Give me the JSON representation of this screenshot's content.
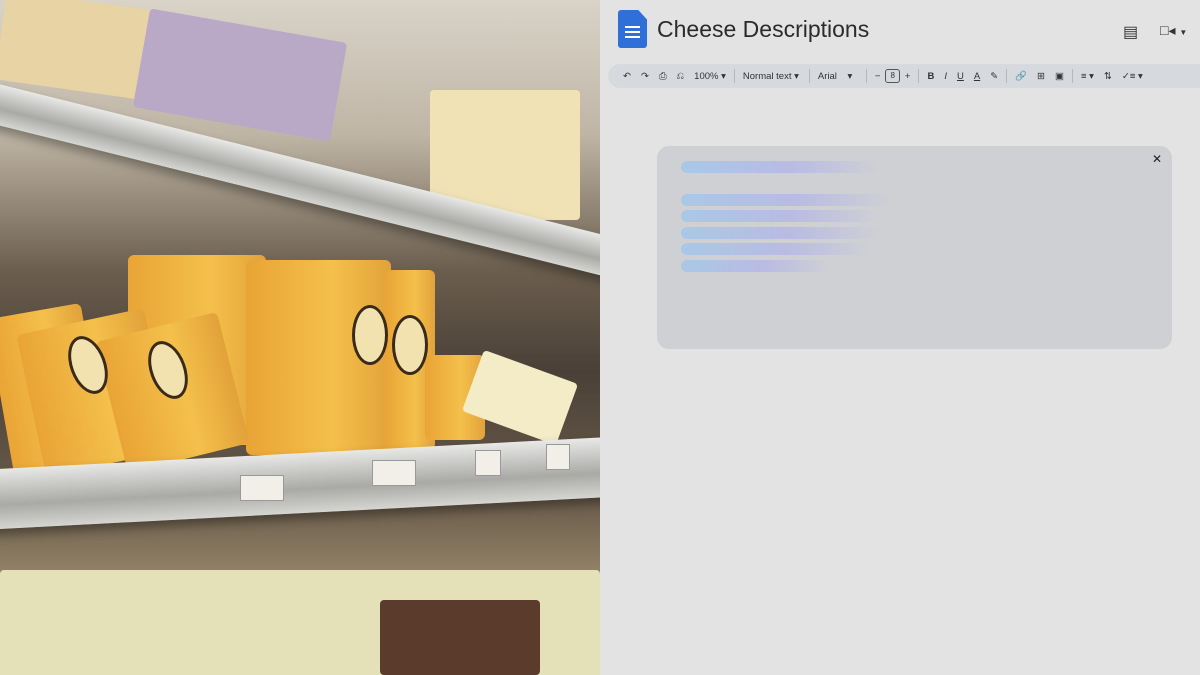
{
  "document": {
    "title": "Cheese Descriptions",
    "app_icon": "google-docs-icon"
  },
  "header": {
    "icons": [
      "comment-history-icon",
      "video-call-icon"
    ]
  },
  "toolbar": {
    "zoom": "100%",
    "style": "Normal text",
    "font": "Arial",
    "font_size": "8",
    "icons": [
      "undo-icon",
      "redo-icon",
      "print-icon",
      "paint-format-icon",
      "bold-icon",
      "italic-icon",
      "underline-icon",
      "text-color-icon",
      "highlight-icon",
      "link-icon",
      "add-comment-icon",
      "image-icon",
      "align-icon",
      "line-spacing-icon",
      "checklist-icon"
    ]
  },
  "card": {
    "state": "loading",
    "close_icon": "close-icon"
  },
  "colors": {
    "accent": "#2f6fd8",
    "background": "#e3e3e3",
    "toolbar": "#d6d9de",
    "card": "#cfd0d4"
  }
}
